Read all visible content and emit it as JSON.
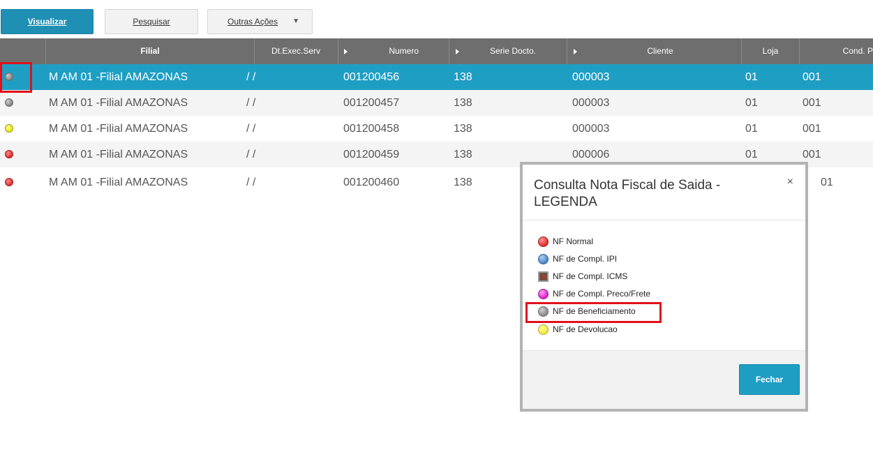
{
  "toolbar": {
    "visualizar": "Visualizar",
    "pesquisar": "Pesquisar",
    "outras_acoes": "Outras Ações"
  },
  "grid": {
    "columns": [
      "Filial",
      "Dt.Exec.Serv",
      "Numero",
      "Serie Docto.",
      "Cliente",
      "Loja",
      "Cond. P"
    ],
    "rows": [
      {
        "status": "gray",
        "filial": "M AM 01 -Filial AMAZONAS",
        "dt": "/ /",
        "numero": "001200456",
        "serie": "138",
        "cliente": "000003",
        "loja": "01",
        "cond": "001"
      },
      {
        "status": "gray",
        "filial": "M AM 01 -Filial AMAZONAS",
        "dt": "/ /",
        "numero": "001200457",
        "serie": "138",
        "cliente": "000003",
        "loja": "01",
        "cond": "001"
      },
      {
        "status": "yellow",
        "filial": "M AM 01 -Filial AMAZONAS",
        "dt": "/ /",
        "numero": "001200458",
        "serie": "138",
        "cliente": "000003",
        "loja": "01",
        "cond": "001"
      },
      {
        "status": "red",
        "filial": "M AM 01 -Filial AMAZONAS",
        "dt": "/ /",
        "numero": "001200459",
        "serie": "138",
        "cliente": "000006",
        "loja": "01",
        "cond": "001"
      },
      {
        "status": "red",
        "filial": "M AM 01 -Filial AMAZONAS",
        "dt": "/ /",
        "numero": "001200460",
        "serie": "138",
        "cliente": "",
        "loja": "01",
        "cond": ""
      }
    ]
  },
  "modal": {
    "title": "Consulta Nota Fiscal de Saida - LEGENDA",
    "close": "×",
    "legend": [
      {
        "icon": "red-circle-icon",
        "label": "NF Normal"
      },
      {
        "icon": "blue-circle-icon",
        "label": "NF de Compl. IPI"
      },
      {
        "icon": "brown-square-icon",
        "label": "NF de Compl. ICMS"
      },
      {
        "icon": "magenta-circle-icon",
        "label": "NF de Compl. Preco/Frete"
      },
      {
        "icon": "gray-circle-icon",
        "label": "NF de Beneficiamento"
      },
      {
        "icon": "yellow-circle-icon",
        "label": "NF de Devolucao"
      }
    ],
    "fechar": "Fechar"
  },
  "colors": {
    "accent": "#1f9ec4",
    "header": "#6e6e6e",
    "highlight": "#e0111a"
  }
}
